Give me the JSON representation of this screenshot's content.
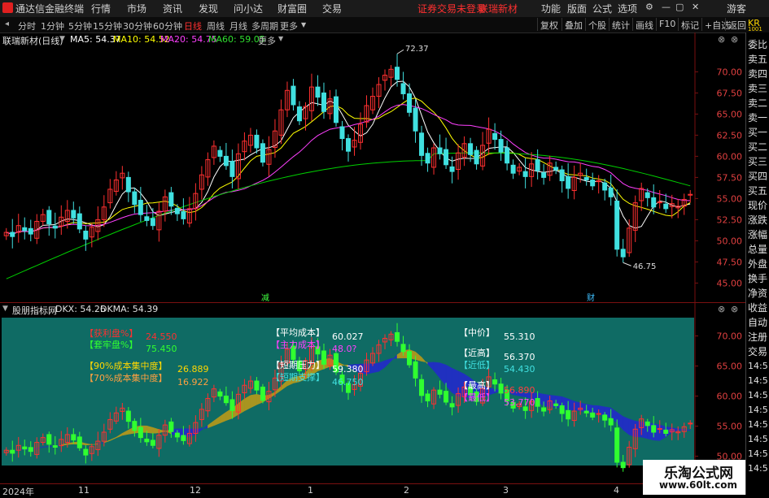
{
  "topbar": {
    "app_title": "通达信金融终端",
    "menus": [
      "行情",
      "市场",
      "资讯",
      "发现",
      "问小达",
      "财富圈",
      "交易"
    ],
    "login_status": "证券交易未登录",
    "stock_name_red": "联瑞新材",
    "right_menus": [
      "功能",
      "版面",
      "公式",
      "选项"
    ],
    "guest": "游客",
    "colors": {
      "accent": "#ff3030",
      "bg": "#1b1b1b"
    }
  },
  "toolbar": {
    "periods": [
      "分时",
      "1分钟",
      "5分钟",
      "15分钟",
      "30分钟",
      "60分钟",
      "日线",
      "周线",
      "月线",
      "多周期",
      "更多"
    ],
    "selected_period": "日线",
    "buttons": [
      "复权",
      "叠加",
      "个股",
      "统计",
      "画线",
      "F10",
      "标记",
      "+自选",
      "返回"
    ]
  },
  "side_panel": {
    "code_fragment": "KR",
    "code_fragment2": "1001",
    "labels": [
      "委比",
      "卖五",
      "卖四",
      "卖三",
      "卖二",
      "卖一",
      "买一",
      "买二",
      "买三",
      "买四",
      "买五",
      "现价",
      "涨跌",
      "涨幅",
      "总量",
      "外盘",
      "换手",
      "净资",
      "收益",
      "自动",
      "注册",
      "交易"
    ],
    "times": [
      "14:5",
      "14:5",
      "14:5",
      "14:5",
      "14:5",
      "14:5",
      "14:5",
      "14:5"
    ]
  },
  "main_legend": {
    "title": "联瑞新材(日线)",
    "ma5": "MA5: 54.37",
    "ma10": "MA10: 54.52",
    "ma20": "MA20: 54.75",
    "ma60": "MA60: 59.05",
    "colors": {
      "ma5": "#ffffff",
      "ma10": "#ffff00",
      "ma20": "#ff40ff",
      "ma60": "#00d000"
    }
  },
  "sub_legend": {
    "title": "股朋指标网",
    "dkx": "DKX: 54.26",
    "dkma": "DKMA: 54.39"
  },
  "overlay_panel": {
    "left": [
      {
        "label": "【获利盘%】",
        "value": "24.550",
        "label_color": "#ff3030",
        "value_color": "#ff3030"
      },
      {
        "label": "【套牢盘%】",
        "value": "75.450",
        "label_color": "#30ff30",
        "value_color": "#30ff30"
      },
      {
        "label": "【90%成本集中度】",
        "value": "26.889",
        "label_color": "#ffd700",
        "value_color": "#ffd700"
      },
      {
        "label": "【70%成本集中度】",
        "value": "16.922",
        "label_color": "#ffa040",
        "value_color": "#ffa040"
      }
    ],
    "middle": [
      {
        "label": "【平均成本】",
        "value": "60.027",
        "label_color": "#ffffff",
        "value_color": "#ffffff"
      },
      {
        "label": "【主力成本】",
        "value": "48.0?",
        "label_color": "#ff40ff",
        "value_color": "#ff40ff"
      },
      {
        "label": "【短期压力】",
        "value": "59.380",
        "label_color": "#ffffff",
        "value_color": "#ffffff"
      },
      {
        "label": "【短期支撑】",
        "value": "46.750",
        "label_color": "#40e0e0",
        "value_color": "#40e0e0"
      }
    ],
    "right": [
      {
        "label": "【中价】",
        "value": "55.310",
        "label_color": "#ffffff",
        "value_color": "#ffffff"
      },
      {
        "label": "【近高】",
        "value": "56.370",
        "label_color": "#ffffff",
        "value_color": "#ffffff"
      },
      {
        "label": "【近低】",
        "value": "54.430",
        "label_color": "#40e0e0",
        "value_color": "#40e0e0"
      },
      {
        "label": "【最高】",
        "value": "56.890",
        "label_color": "#ffffff",
        "value_color": "#ff4040"
      },
      {
        "label": "【最低】",
        "value": "53.770",
        "label_color": "#ff40ff",
        "value_color": "#ff40ff"
      }
    ],
    "bg_color": "#0f6b64"
  },
  "x_axis_labels": [
    "2024年",
    "11",
    "12",
    "1",
    "2",
    "3",
    "4"
  ],
  "markers": {
    "dec": "减",
    "cai": "财"
  },
  "watermark": {
    "line1": "乐淘公式网",
    "line2": "www.60lt.com"
  },
  "chart_data": [
    {
      "type": "line",
      "title": "联瑞新材(日线)",
      "note": "Candlestick price chart with moving averages",
      "y_ticks": [
        45.0,
        47.5,
        50.0,
        52.5,
        55.0,
        57.5,
        60.0,
        62.5,
        65.0,
        67.5,
        70.0
      ],
      "ylim": [
        43.5,
        73.5
      ],
      "annotations": [
        {
          "label": "72.37",
          "kind": "high"
        },
        {
          "label": "46.75",
          "kind": "low"
        }
      ],
      "candles_close": [
        51.0,
        50.5,
        51.8,
        51.2,
        50.8,
        52.3,
        53.1,
        52.0,
        51.5,
        52.8,
        53.6,
        52.7,
        51.4,
        50.2,
        51.6,
        52.5,
        54.0,
        56.1,
        57.2,
        58.0,
        55.8,
        54.3,
        53.1,
        52.4,
        51.8,
        53.5,
        55.2,
        54.1,
        53.2,
        52.6,
        53.8,
        55.6,
        57.8,
        59.6,
        61.2,
        60.0,
        58.9,
        57.6,
        60.3,
        61.8,
        62.5,
        61.0,
        59.3,
        60.8,
        63.0,
        65.5,
        67.8,
        66.1,
        64.2,
        65.9,
        68.2,
        67.0,
        65.3,
        66.8,
        64.0,
        62.1,
        60.6,
        61.9,
        63.8,
        66.0,
        67.1,
        68.5,
        69.6,
        70.3,
        69.1,
        67.4,
        65.2,
        63.0,
        60.1,
        59.2,
        61.0,
        60.3,
        59.0,
        58.2,
        60.4,
        61.5,
        60.2,
        59.1,
        61.3,
        63.2,
        62.0,
        60.5,
        59.2,
        58.0,
        58.7,
        57.6,
        59.1,
        58.3,
        57.5,
        59.2,
        58.4,
        57.1,
        56.2,
        57.5,
        58.0,
        57.2,
        56.5,
        57.1,
        56.0,
        55.2,
        49.0,
        48.1,
        51.5,
        54.5,
        56.2,
        55.1,
        54.0,
        54.6,
        53.8,
        54.4,
        54.1,
        54.9,
        55.5
      ],
      "series": [
        {
          "name": "MA5",
          "color": "#ffffff",
          "last": 54.37
        },
        {
          "name": "MA10",
          "color": "#ffff00",
          "last": 54.52
        },
        {
          "name": "MA20",
          "color": "#ff40ff",
          "last": 54.75
        },
        {
          "name": "MA60",
          "color": "#00d000",
          "last": 59.05
        }
      ]
    },
    {
      "type": "area",
      "title": "股朋指标网",
      "y_ticks": [
        50.0,
        55.0,
        60.0,
        65.0,
        70.0
      ],
      "ylim": [
        49.0,
        72.5
      ],
      "series": [
        {
          "name": "DKX",
          "last": 54.26
        },
        {
          "name": "DKMA",
          "last": 54.39
        }
      ]
    }
  ]
}
